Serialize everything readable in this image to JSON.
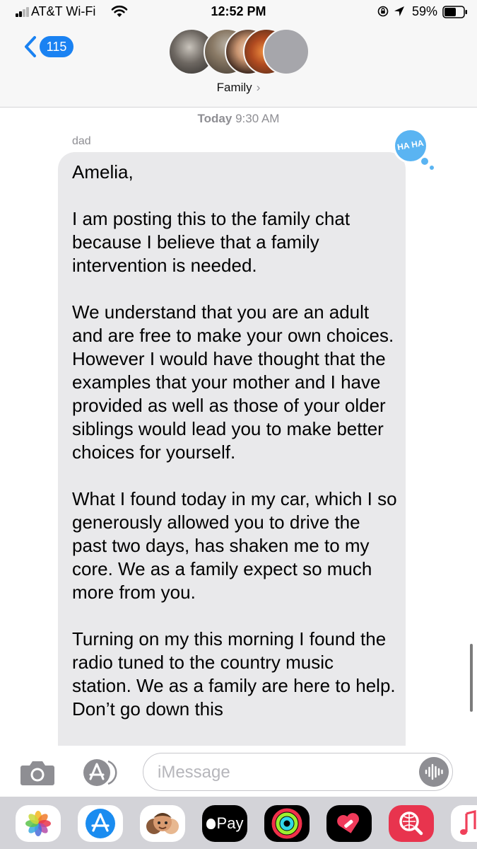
{
  "status_bar": {
    "carrier": "AT&T Wi-Fi",
    "time": "12:52 PM",
    "battery": "59%"
  },
  "header": {
    "back_count": "115",
    "group_name": "Family",
    "chevron": "›"
  },
  "transcript": {
    "timestamp_day": "Today",
    "timestamp_time": "9:30 AM",
    "sender": "dad",
    "tapback_text": "HA HA",
    "message_paragraphs": [
      "Amelia,",
      "I am posting this to the family chat because I believe that a family intervention is needed.",
      "We understand that you are an adult and are free to make your own choices. However I would have thought that the examples that your mother and I have provided as well as those of your older siblings would lead you to make better choices for yourself.",
      "What I found today in my car, which I so generously allowed you to drive the past two days, has shaken me to my core.  We as a family expect so much more from you.",
      "Turning on my this morning I found the radio tuned to the country music station.  We as a family are here to help. Don’t go down this"
    ]
  },
  "compose": {
    "placeholder": "iMessage"
  },
  "app_drawer": {
    "apple_pay_label": "Pay",
    "apps": [
      "photos-app",
      "app-store-app",
      "memoji-app",
      "apple-pay-app",
      "activity-app",
      "heart-sticker-app",
      "web-search-app",
      "music-app"
    ]
  },
  "colors": {
    "accent_blue": "#1a82f2",
    "bubble_gray": "#e9e9eb",
    "tapback_blue": "#5ab4f2"
  }
}
